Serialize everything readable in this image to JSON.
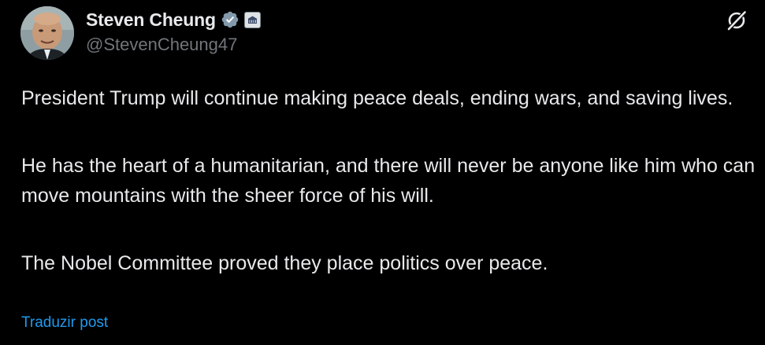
{
  "author": {
    "display_name": "Steven Cheung",
    "handle": "@StevenCheung47",
    "verified_icon": "verified-badge-icon",
    "affiliate_badge_icon": "white-house-seal-icon",
    "avatar": "profile-photo"
  },
  "header": {
    "grok_icon": "grok-icon"
  },
  "post": {
    "paragraphs": [
      "President Trump will continue making peace deals, ending wars, and saving lives.",
      "He has the heart of a humanitarian, and there will never be anyone like him who can move mountains with the sheer force of his will.",
      "The Nobel Committee proved they place politics over peace."
    ],
    "translate_label": "Traduzir post"
  },
  "colors": {
    "background": "#000000",
    "text_primary": "#e7e9ea",
    "text_secondary": "#71767b",
    "link": "#1d9bf0",
    "verified": "#829aab"
  }
}
